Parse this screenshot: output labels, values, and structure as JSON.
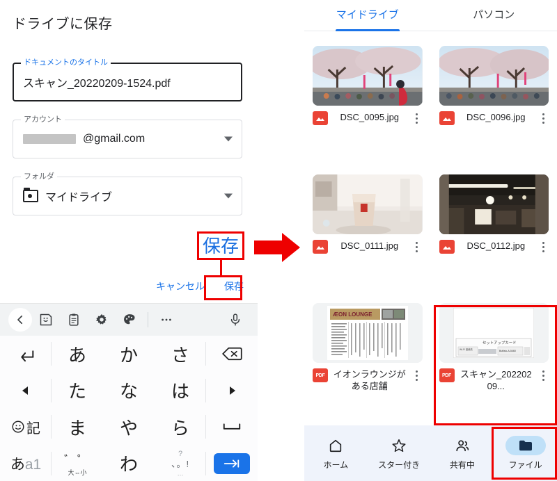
{
  "dialog": {
    "title": "ドライブに保存",
    "fields": [
      {
        "label": "ドキュメントのタイトル",
        "value": "スキャン_20220209-1524.pdf",
        "state": "focused"
      },
      {
        "label": "アカウント",
        "value": "@gmail.com",
        "state": "normal",
        "redacted": true
      },
      {
        "label": "フォルダ",
        "value": "マイドライブ",
        "state": "normal",
        "icon": "folder-icon"
      }
    ],
    "cancel_label": "キャンセル",
    "save_label": "保存",
    "callout_label": "保存"
  },
  "keyboard": {
    "toolbar": [
      "chevron-left-icon",
      "sticker-icon",
      "clipboard-icon",
      "gear-icon",
      "palette-icon",
      "divider",
      "more-horizontal-icon",
      "microphone-icon"
    ],
    "keys": [
      "undo-arrow",
      "あ",
      "か",
      "さ",
      "backspace",
      "cursor-left",
      "た",
      "な",
      "は",
      "cursor-right",
      "emoji-symbols",
      "ま",
      "や",
      "ら",
      "space",
      "mode-aa1",
      "dakuten",
      "わ",
      "punctuation",
      "enter"
    ],
    "key_labels": {
      "mode_main": "あ",
      "mode_sub": "a1",
      "emoji_text": "記",
      "dakuten_top": "゛゜",
      "dakuten_bottom": "大⇔小",
      "punct_q": "?",
      "punct_row": "、。!",
      "punct_more": "…"
    }
  },
  "drive": {
    "tabs": [
      {
        "label": "マイドライブ",
        "active": true
      },
      {
        "label": "パソコン",
        "active": false
      }
    ],
    "files": [
      {
        "name": "DSC_0095.jpg",
        "type": "image",
        "thumb": "cherry-blossom-crowd"
      },
      {
        "name": "DSC_0096.jpg",
        "type": "image",
        "thumb": "cherry-blossom-crowd"
      },
      {
        "name": "DSC_0111.jpg",
        "type": "image",
        "thumb": "drink-cup-mall"
      },
      {
        "name": "DSC_0112.jpg",
        "type": "image",
        "thumb": "dark-lounge-interior"
      },
      {
        "name": "イオンラウンジがある店舗",
        "type": "pdf",
        "thumb": "aeon-lounge-document"
      },
      {
        "name": "スキャン_20220209...",
        "type": "pdf",
        "thumb": "setup-card-scan",
        "highlighted": true
      }
    ],
    "file_type_badge": "PDF",
    "thumb_text": {
      "aeon_header": "ÆON LOUNGE",
      "setup_card_title": "セットアップカード"
    },
    "bottom_nav": [
      {
        "label": "ホーム",
        "icon": "home-icon",
        "active": false
      },
      {
        "label": "スター付き",
        "icon": "star-icon",
        "active": false
      },
      {
        "label": "共有中",
        "icon": "people-icon",
        "active": false
      },
      {
        "label": "ファイル",
        "icon": "folder-icon",
        "active": true
      }
    ]
  },
  "annotations": {
    "arrow": "red-right-arrow",
    "accent_red": "#ee0000",
    "accent_blue": "#1a73e8"
  }
}
